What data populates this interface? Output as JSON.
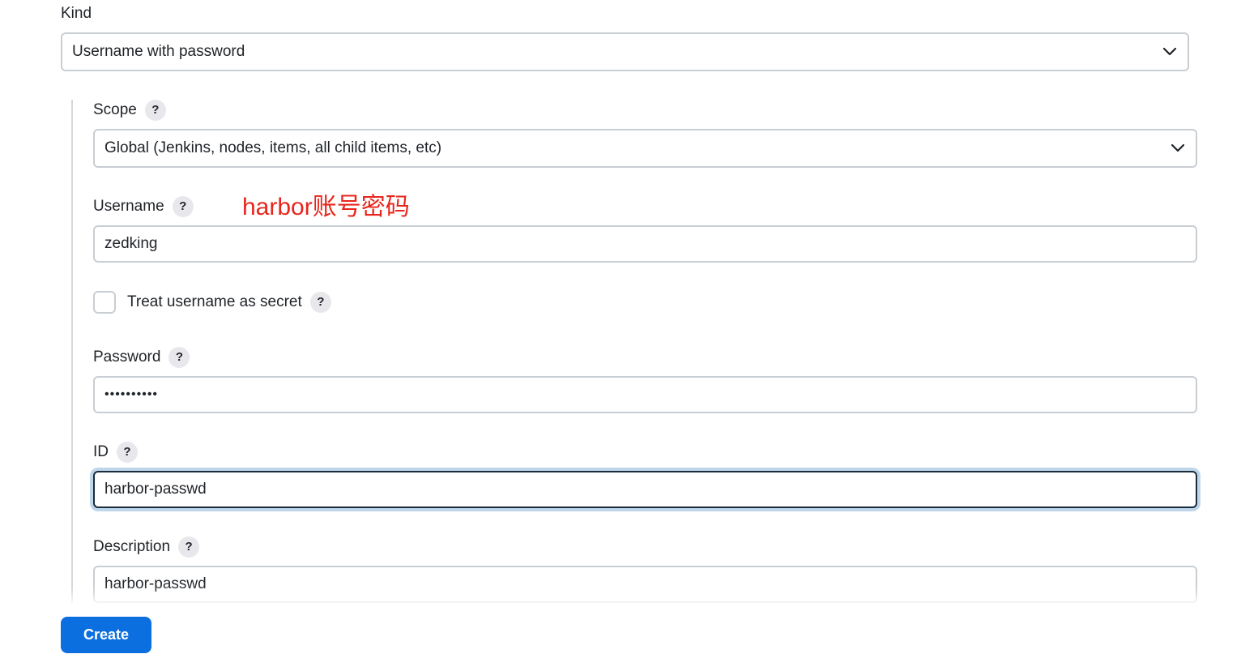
{
  "kind": {
    "label": "Kind",
    "value": "Username with password"
  },
  "scope": {
    "label": "Scope",
    "value": "Global (Jenkins, nodes, items, all child items, etc)"
  },
  "username": {
    "label": "Username",
    "value": "zedking"
  },
  "annotation": {
    "text": "harbor账号密码",
    "color": "#e8251c"
  },
  "treat_username_secret": {
    "label": "Treat username as secret",
    "checked": false
  },
  "password": {
    "label": "Password",
    "masked_value": "••••••••••"
  },
  "id": {
    "label": "ID",
    "value": "harbor-passwd"
  },
  "description": {
    "label": "Description",
    "value": "harbor-passwd"
  },
  "help_icon_glyph": "?",
  "actions": {
    "create_label": "Create",
    "accent_color": "#0b6fe0"
  }
}
